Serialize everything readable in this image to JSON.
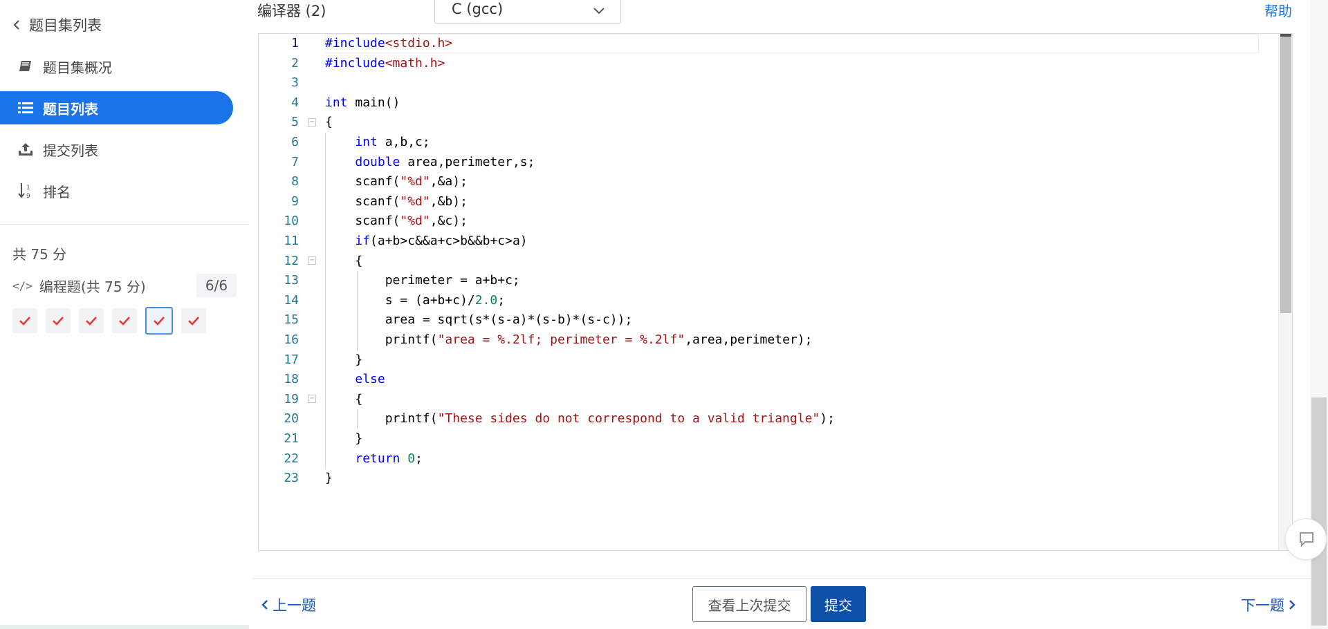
{
  "sidebar": {
    "back_label": "题目集列表",
    "items": [
      {
        "label": "题目集概况",
        "icon": "book-icon"
      },
      {
        "label": "题目列表",
        "icon": "list-icon",
        "active": true
      },
      {
        "label": "提交列表",
        "icon": "upload-icon"
      },
      {
        "label": "排名",
        "icon": "sort-numeric-icon"
      }
    ],
    "total_score": "共 75 分",
    "section": {
      "label": "编程题(共 75 分)",
      "count": "6/6"
    },
    "problems": [
      {
        "status": "accepted",
        "current": false
      },
      {
        "status": "accepted",
        "current": false
      },
      {
        "status": "accepted",
        "current": false
      },
      {
        "status": "accepted",
        "current": false
      },
      {
        "status": "accepted",
        "current": true
      },
      {
        "status": "accepted",
        "current": false
      }
    ]
  },
  "header": {
    "compiler_label": "编译器 (2)",
    "compiler_selected": "C (gcc)",
    "help_label": "帮助"
  },
  "editor": {
    "line_numbers": [
      "1",
      "2",
      "3",
      "4",
      "5",
      "6",
      "7",
      "8",
      "9",
      "10",
      "11",
      "12",
      "13",
      "14",
      "15",
      "16",
      "17",
      "18",
      "19",
      "20",
      "21",
      "22",
      "23"
    ],
    "code_lines": [
      "#include<stdio.h>",
      "#include<math.h>",
      "",
      "int main()",
      "{",
      "    int a,b,c;",
      "    double area,perimeter,s;",
      "    scanf(\"%d\",&a);",
      "    scanf(\"%d\",&b);",
      "    scanf(\"%d\",&c);",
      "    if(a+b>c&&a+c>b&&b+c>a)",
      "    {",
      "        perimeter = a+b+c;",
      "        s = (a+b+c)/2.0;",
      "        area = sqrt(s*(s-a)*(s-b)*(s-c));",
      "        printf(\"area = %.2lf; perimeter = %.2lf\",area,perimeter);",
      "    }",
      "    else",
      "    {",
      "        printf(\"These sides do not correspond to a valid triangle\");",
      "    }",
      "    return 0;",
      "}"
    ]
  },
  "footer": {
    "prev_label": "上一题",
    "next_label": "下一题",
    "view_last_label": "查看上次提交",
    "submit_label": "提交"
  },
  "colors": {
    "accent": "#1a73e8",
    "submit": "#0d4ea6",
    "check": "#e53935",
    "keyword": "#0000ff",
    "string": "#a31515",
    "number": "#098658",
    "line_number": "#237893"
  }
}
